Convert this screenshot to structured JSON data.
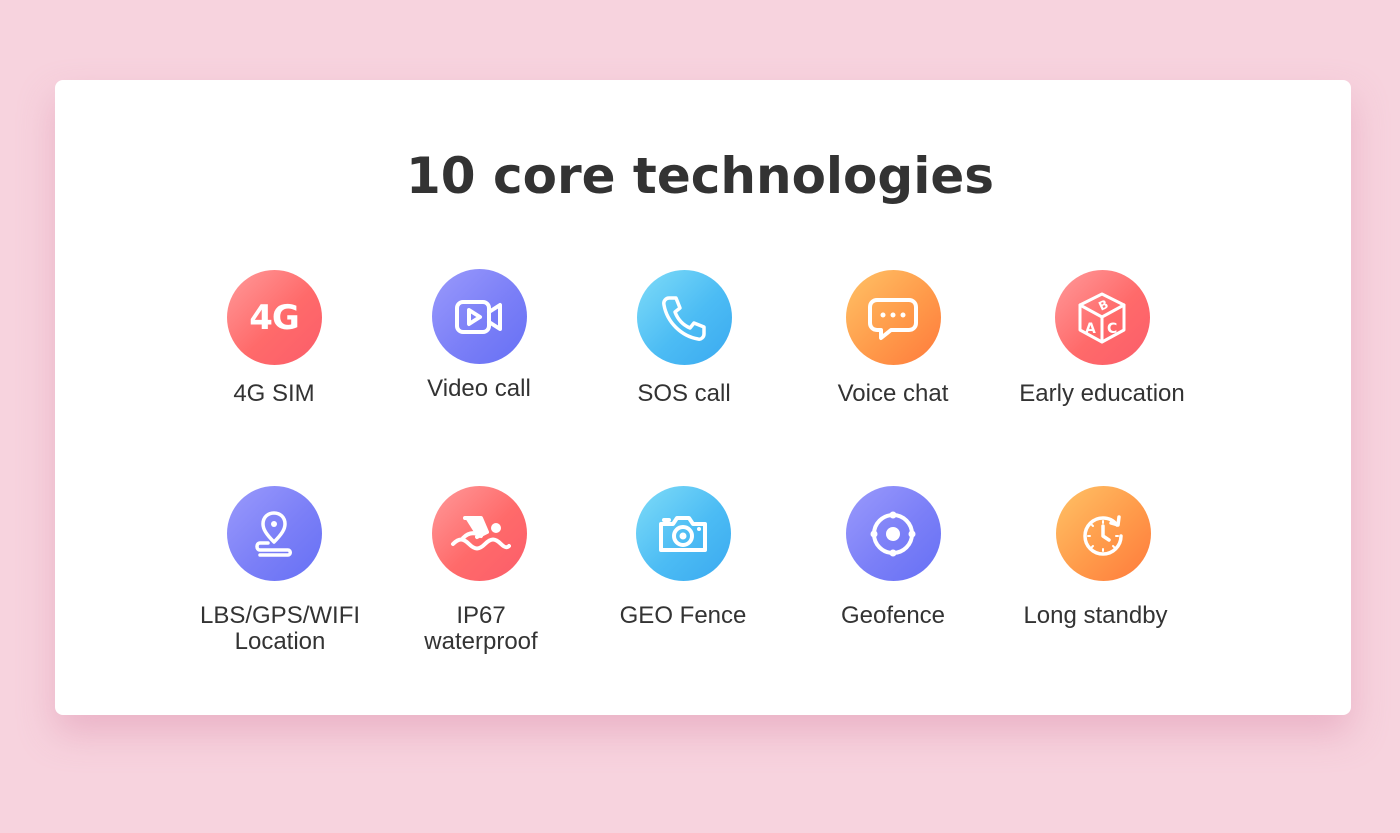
{
  "title": "10 core technologies",
  "colors": {
    "background": "#f7d3de",
    "card": "#ffffff",
    "text": "#333333",
    "red_gradient": [
      "#ff9a9a",
      "#fb5d6a"
    ],
    "purple_gradient": [
      "#9a9afc",
      "#6670f5"
    ],
    "blue_gradient": [
      "#7fdcf8",
      "#3aa9f0"
    ],
    "orange_gradient": [
      "#ffc266",
      "#ff7a3c"
    ]
  },
  "features": [
    {
      "label": "4G SIM",
      "icon": "4g-icon",
      "icon_text": "4G",
      "color": "red"
    },
    {
      "label": "Video call",
      "icon": "video-camera-icon",
      "color": "purple"
    },
    {
      "label": "SOS call",
      "icon": "phone-icon",
      "color": "blue"
    },
    {
      "label": "Voice chat",
      "icon": "chat-bubble-icon",
      "color": "orange"
    },
    {
      "label": "Early education",
      "icon": "abc-block-icon",
      "color": "red"
    },
    {
      "label": "LBS/GPS/WIFI\nLocation",
      "icon": "location-pin-icon",
      "color": "purple"
    },
    {
      "label": "IP67\nwaterproof",
      "icon": "swimmer-icon",
      "color": "red"
    },
    {
      "label": "GEO Fence",
      "icon": "camera-icon",
      "color": "blue"
    },
    {
      "label": "Geofence",
      "icon": "target-icon",
      "color": "purple"
    },
    {
      "label": "Long standby",
      "icon": "clock-refresh-icon",
      "color": "orange"
    }
  ]
}
